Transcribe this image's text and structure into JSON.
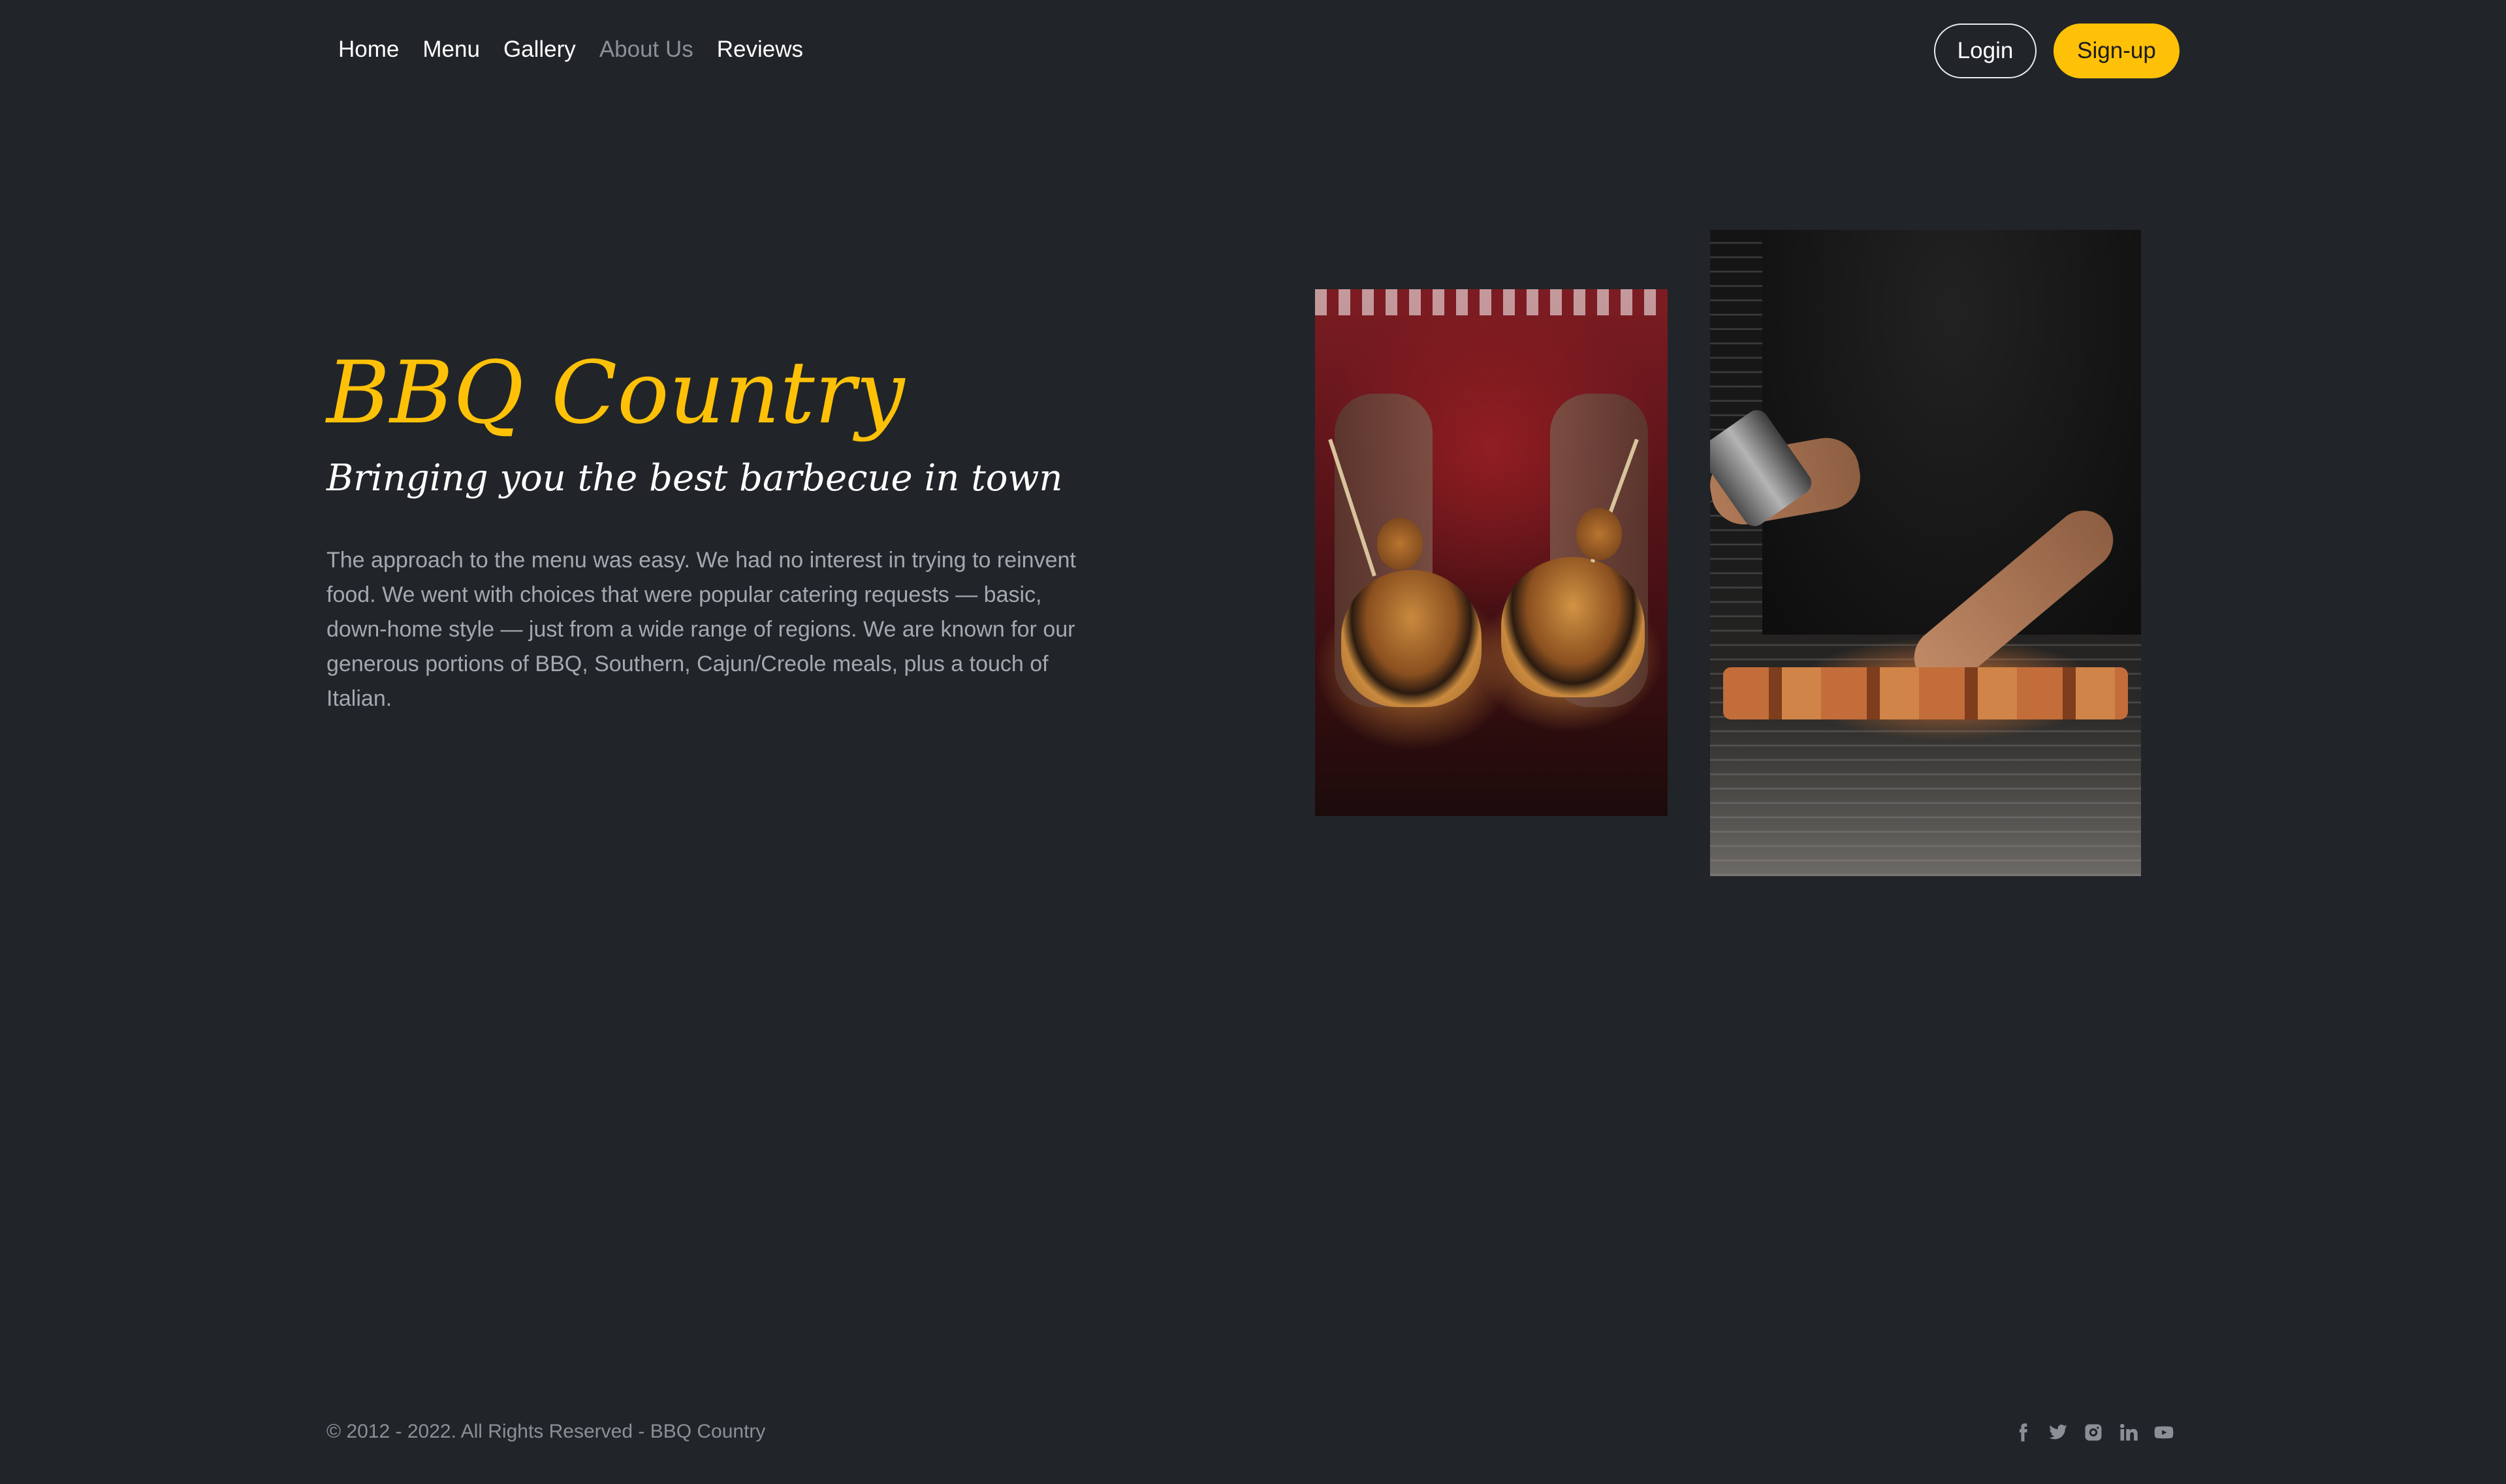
{
  "nav": {
    "items": [
      {
        "label": "Home",
        "active": false
      },
      {
        "label": "Menu",
        "active": false
      },
      {
        "label": "Gallery",
        "active": false
      },
      {
        "label": "About Us",
        "active": true
      },
      {
        "label": "Reviews",
        "active": false
      }
    ],
    "login_label": "Login",
    "signup_label": "Sign-up"
  },
  "hero": {
    "title": "BBQ Country",
    "subtitle": "Bringing you the best barbecue in town",
    "body": "The approach to the menu was easy. We had no interest in trying to reinvent food. We went with choices that were popular catering requests — basic, down-home style — just from a wide range of regions. We are known for our generous portions of BBQ, Southern, Cajun/Creole meals, plus a touch of Italian."
  },
  "footer": {
    "copyright": "© 2012 - 2022. All Rights Reserved - BBQ Country",
    "social": [
      "facebook-icon",
      "twitter-icon",
      "instagram-icon",
      "linkedin-icon",
      "youtube-icon"
    ]
  },
  "colors": {
    "background": "#212529",
    "accent": "#ffc107",
    "muted_text": "#a4a9af"
  }
}
